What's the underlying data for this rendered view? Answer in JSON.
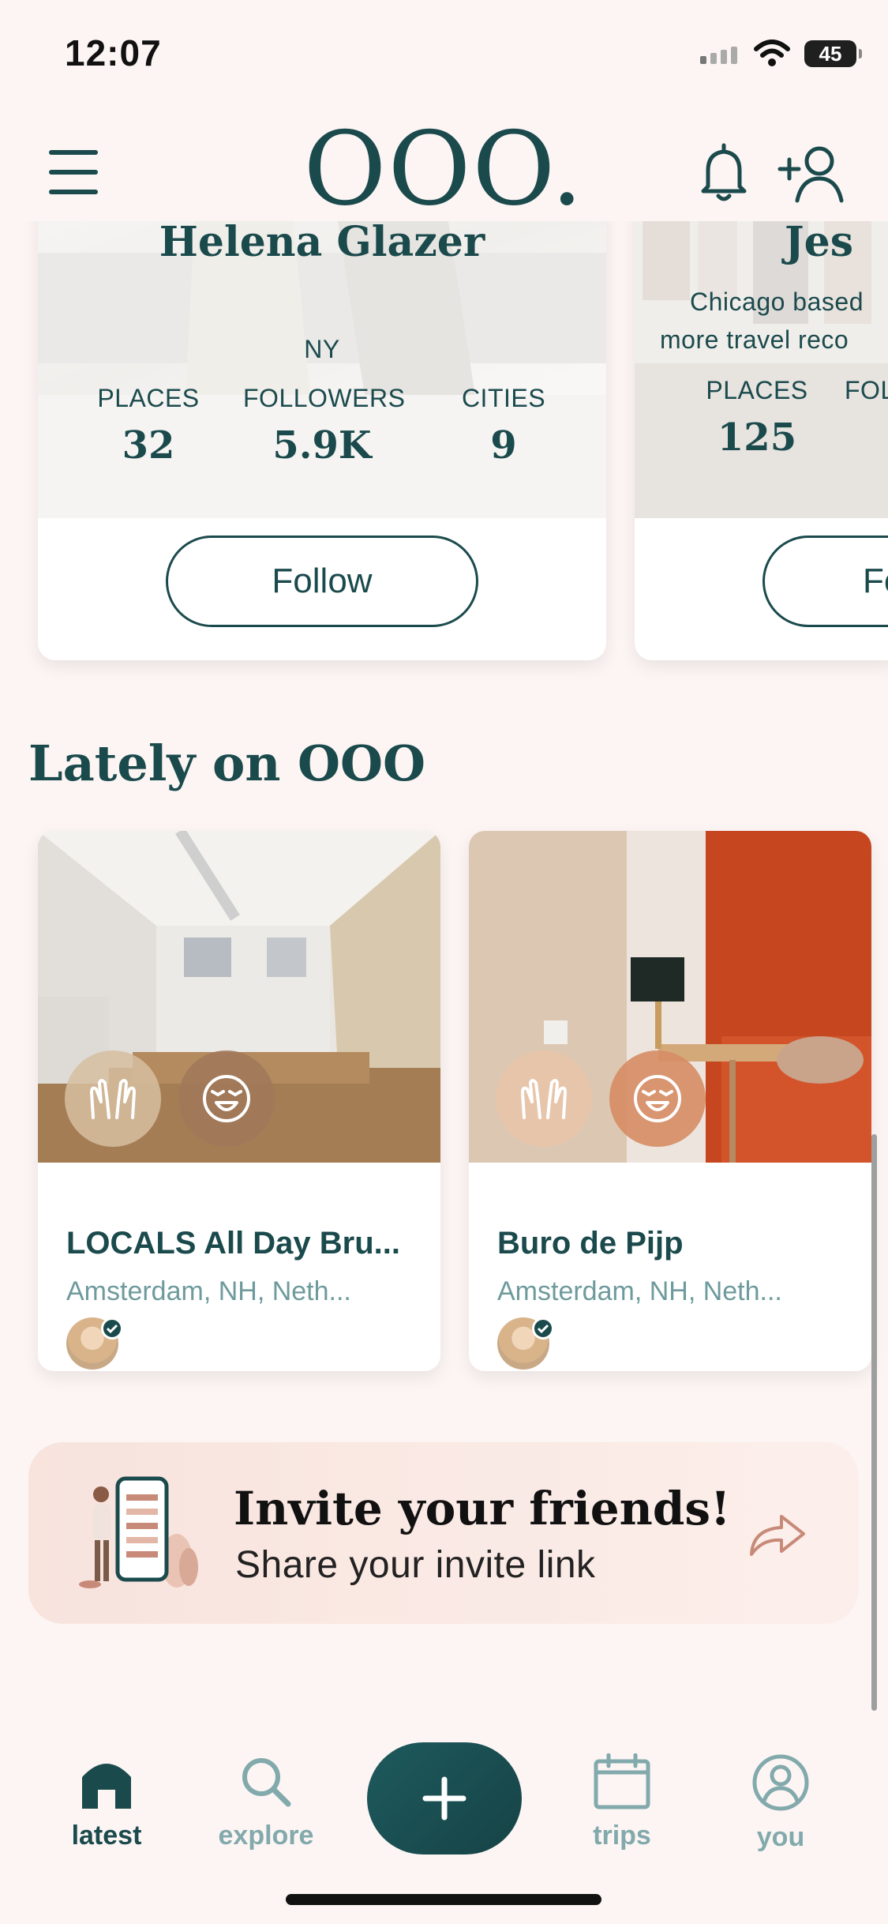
{
  "status_bar": {
    "time": "12:07",
    "battery": "45"
  },
  "header": {
    "logo": "OOO."
  },
  "profiles": [
    {
      "name": "Helena Glazer",
      "bio": "NY",
      "stats": [
        {
          "label": "PLACES",
          "value": "32"
        },
        {
          "label": "FOLLOWERS",
          "value": "5.9K"
        },
        {
          "label": "CITIES",
          "value": "9"
        }
      ],
      "follow_label": "Follow"
    },
    {
      "name": "Jes",
      "bio_line1": "Chicago based",
      "bio_line2": "more travel reco",
      "stats": [
        {
          "label": "PLACES",
          "value": "125"
        },
        {
          "label": "FOL"
        }
      ],
      "follow_label": "Fo"
    }
  ],
  "section_title": "Lately on OOO",
  "places": [
    {
      "title": "LOCALS All Day Bru...",
      "location": "Amsterdam, NH, Neth..."
    },
    {
      "title": "Buro de Pijp",
      "location": "Amsterdam, NH, Neth..."
    }
  ],
  "invite": {
    "title": "Invite your friends!",
    "subtitle": "Share your invite link"
  },
  "nav": {
    "latest": "latest",
    "explore": "explore",
    "trips": "trips",
    "you": "you"
  },
  "colors": {
    "brand": "#1b4a4d",
    "muted_teal": "#82a9ab",
    "background": "#fcf5f3",
    "invite_bg": "#f8e3dd",
    "accent_rust": "#c88a78"
  },
  "icons": [
    "menu-icon",
    "bell-icon",
    "add-user-icon",
    "raised-hands-icon",
    "starstruck-face-icon",
    "verified-icon",
    "share-arrow-icon",
    "home-icon",
    "search-icon",
    "plus-icon",
    "calendar-icon",
    "user-icon"
  ]
}
